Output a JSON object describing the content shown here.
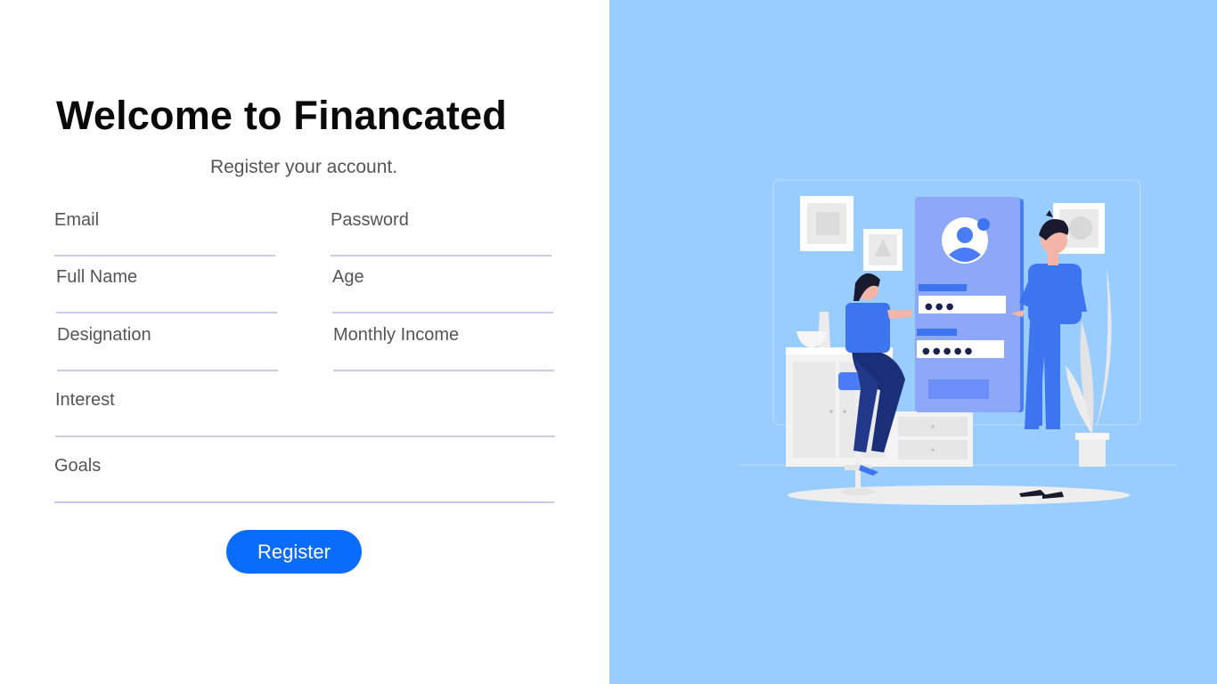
{
  "header": {
    "title": "Welcome to Financated",
    "subtitle": "Register your account."
  },
  "form": {
    "email_label": "Email",
    "password_label": "Password",
    "fullname_label": "Full Name",
    "age_label": "Age",
    "designation_label": "Designation",
    "income_label": "Monthly Income",
    "interest_label": "Interest",
    "goals_label": "Goals",
    "register_label": "Register"
  },
  "colors": {
    "accent": "#0a6cfb",
    "panel_background": "#99ccff",
    "field_underline": "#c9cbe8",
    "illustration_blue": "#3d74f0"
  },
  "illustration": {
    "icon": "registration-illustration",
    "masked_password_short": "● ● ●",
    "masked_password_long": "● ● ● ● ●"
  }
}
